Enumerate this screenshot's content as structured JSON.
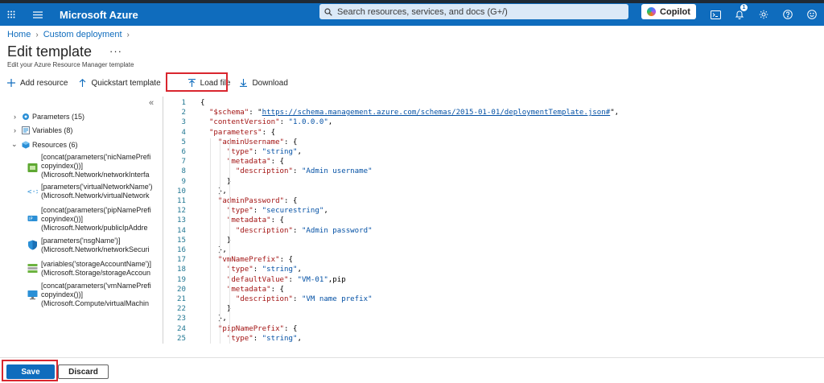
{
  "topbar": {
    "brand": "Microsoft Azure",
    "search_placeholder": "Search resources, services, and docs (G+/)",
    "copilot_label": "Copilot",
    "notification_count": "1",
    "bar_color": "#0f6cbd"
  },
  "breadcrumb": [
    "Home",
    "Custom deployment"
  ],
  "page": {
    "title": "Edit template",
    "ellipsis": "···",
    "subtitle": "Edit your Azure Resource Manager template"
  },
  "toolbar": {
    "add_resource": "Add resource",
    "quickstart": "Quickstart template",
    "load_file": "Load file",
    "download": "Download"
  },
  "tree": {
    "parameters": "Parameters (15)",
    "variables": "Variables (8)",
    "resources": "Resources (6)",
    "resource_items": [
      {
        "icon": "network-interface-icon",
        "lines": [
          "[concat(parameters('nicNamePrefi",
          "copyindex())]",
          "(Microsoft.Network/networkInterfa"
        ]
      },
      {
        "icon": "virtual-network-icon",
        "lines": [
          "[parameters('virtualNetworkName')",
          "(Microsoft.Network/virtualNetwork"
        ]
      },
      {
        "icon": "public-ip-icon",
        "lines": [
          "[concat(parameters('pipNamePrefi",
          "copyindex())]",
          "(Microsoft.Network/publicIpAddre"
        ]
      },
      {
        "icon": "network-security-group-icon",
        "lines": [
          "[parameters('nsgName')]",
          "(Microsoft.Network/networkSecuri"
        ]
      },
      {
        "icon": "storage-account-icon",
        "lines": [
          "[variables('storageAccountName')]",
          "(Microsoft.Storage/storageAccoun"
        ]
      },
      {
        "icon": "virtual-machine-icon",
        "lines": [
          "[concat(parameters('vmNamePrefi",
          "copyindex())]",
          "(Microsoft.Compute/virtualMachin"
        ]
      }
    ]
  },
  "editor": {
    "lines": [
      "{",
      "  \"$schema\": \"https://schema.management.azure.com/schemas/2015-01-01/deploymentTemplate.json#\",",
      "  \"contentVersion\": \"1.0.0.0\",",
      "  \"parameters\": {",
      "    \"adminUsername\": {",
      "      \"type\": \"string\",",
      "      \"metadata\": {",
      "        \"description\": \"Admin username\"",
      "      }",
      "    },",
      "    \"adminPassword\": {",
      "      \"type\": \"securestring\",",
      "      \"metadata\": {",
      "        \"description\": \"Admin password\"",
      "      }",
      "    },",
      "    \"vmNamePrefix\": {",
      "      \"type\": \"string\",",
      "      \"defaultValue\": \"VM-01\",pip",
      "      \"metadata\": {",
      "        \"description\": \"VM name prefix\"",
      "      }",
      "    },",
      "    \"pipNamePrefix\": {",
      "      \"type\": \"string\","
    ]
  },
  "footer": {
    "save": "Save",
    "discard": "Discard"
  }
}
